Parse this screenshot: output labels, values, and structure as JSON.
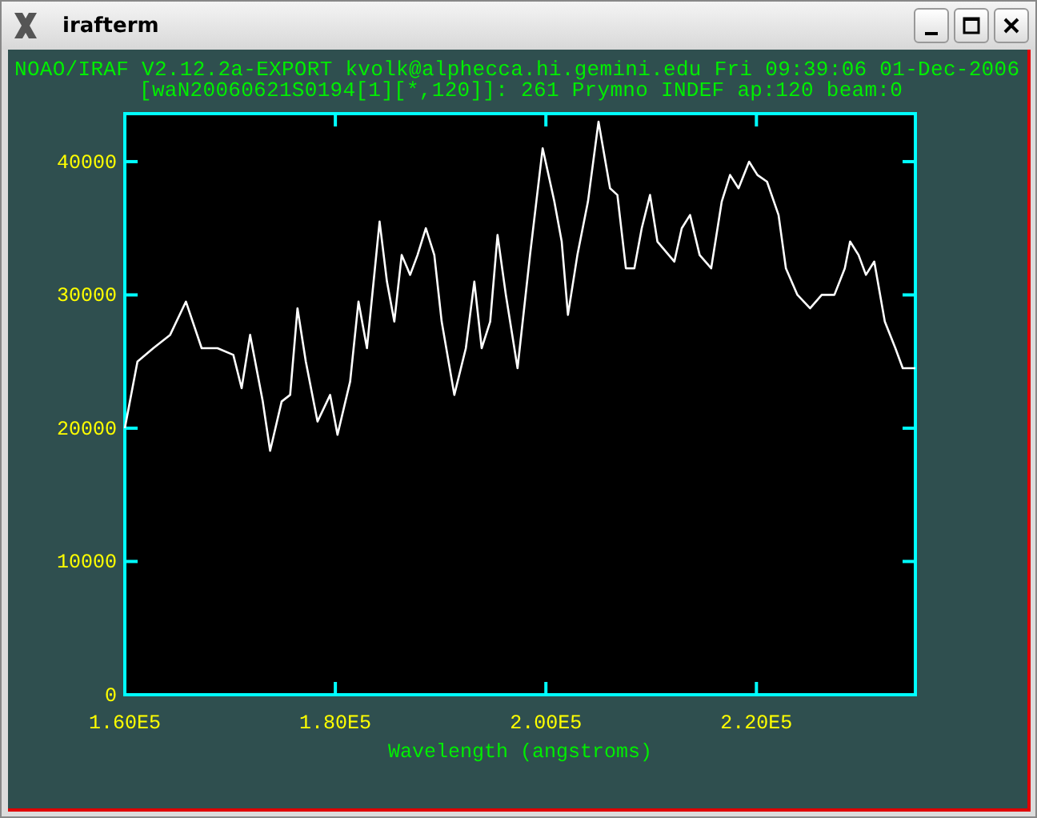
{
  "window": {
    "title": "irafterm"
  },
  "header": [
    "NOAO/IRAF V2.12.2a-EXPORT kvolk@alphecca.hi.gemini.edu Fri 09:39:06 01-Dec-2006",
    "[waN20060621S0194[1][*,120]]: 261 Prymno INDEF ap:120 beam:0"
  ],
  "chart_data": {
    "type": "line",
    "xlabel": "Wavelength (angstroms)",
    "xlim": [
      160000,
      235100
    ],
    "ylim": [
      0,
      43600
    ],
    "xticks": [
      {
        "value": 160000,
        "label": "1.60E5"
      },
      {
        "value": 180000,
        "label": "1.80E5"
      },
      {
        "value": 200000,
        "label": "2.00E5"
      },
      {
        "value": 220000,
        "label": "2.20E5"
      }
    ],
    "yticks": [
      0,
      10000,
      20000,
      30000,
      40000
    ],
    "x": [
      160000,
      161200,
      162700,
      164300,
      165800,
      167300,
      168800,
      170300,
      171100,
      171900,
      173100,
      173800,
      174900,
      175700,
      176400,
      177200,
      178300,
      179500,
      180200,
      181400,
      182200,
      183000,
      184200,
      184900,
      185600,
      186300,
      187100,
      187800,
      188600,
      189400,
      190100,
      191300,
      192400,
      193200,
      193900,
      194700,
      195400,
      196200,
      197300,
      198500,
      199700,
      200800,
      201500,
      202100,
      203000,
      204000,
      205000,
      206100,
      206800,
      207600,
      208400,
      209100,
      209900,
      210600,
      212200,
      212900,
      213700,
      214600,
      215700,
      216700,
      217500,
      218300,
      219300,
      220100,
      221000,
      222100,
      222800,
      223900,
      225100,
      226200,
      227400,
      228400,
      228900,
      229700,
      230400,
      231200,
      232200,
      233200,
      233900,
      235100
    ],
    "series": [
      {
        "color": "#ffffff",
        "values": [
          20000,
          25000,
          26000,
          27000,
          29500,
          26000,
          26000,
          25500,
          23000,
          27000,
          22000,
          18300,
          22000,
          22500,
          29000,
          25000,
          20500,
          22500,
          19500,
          23500,
          29500,
          26000,
          35500,
          31000,
          28000,
          33000,
          31500,
          33000,
          35000,
          33000,
          28000,
          22500,
          26000,
          31000,
          26000,
          28000,
          34500,
          30000,
          24500,
          33000,
          41000,
          37000,
          34000,
          28500,
          33000,
          37000,
          43000,
          38000,
          37500,
          32000,
          32000,
          35000,
          37500,
          34000,
          32500,
          35000,
          36000,
          33000,
          32000,
          37000,
          39000,
          38000,
          40000,
          39000,
          38500,
          36000,
          32000,
          30000,
          29000,
          30000,
          30000,
          32000,
          34000,
          33000,
          31500,
          32500,
          28000,
          26000,
          24500,
          24500
        ]
      }
    ]
  }
}
